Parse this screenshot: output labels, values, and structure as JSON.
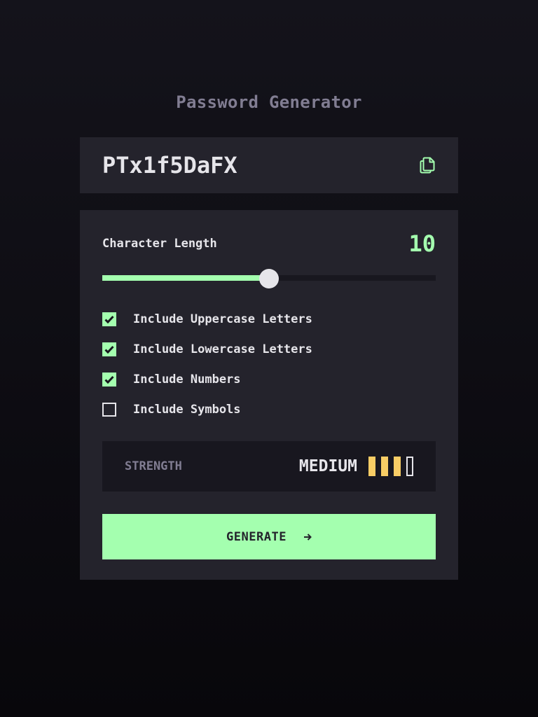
{
  "app": {
    "title": "Password Generator"
  },
  "password": {
    "value": "PTx1f5DaFX",
    "copy_icon": "copy-icon"
  },
  "length": {
    "label": "Character Length",
    "value": "10",
    "slider_fraction": 0.5
  },
  "options": [
    {
      "label": "Include Uppercase Letters",
      "checked": true
    },
    {
      "label": "Include Lowercase Letters",
      "checked": true
    },
    {
      "label": "Include Numbers",
      "checked": true
    },
    {
      "label": "Include Symbols",
      "checked": false
    }
  ],
  "strength": {
    "label": "STRENGTH",
    "value": "MEDIUM",
    "level": 3,
    "max": 4
  },
  "generate": {
    "label": "GENERATE",
    "icon": "arrow-right-icon"
  },
  "colors": {
    "accent": "#a4ffaf",
    "strength_medium": "#f8cd65",
    "panel": "#24232c",
    "muted": "#817d92"
  }
}
